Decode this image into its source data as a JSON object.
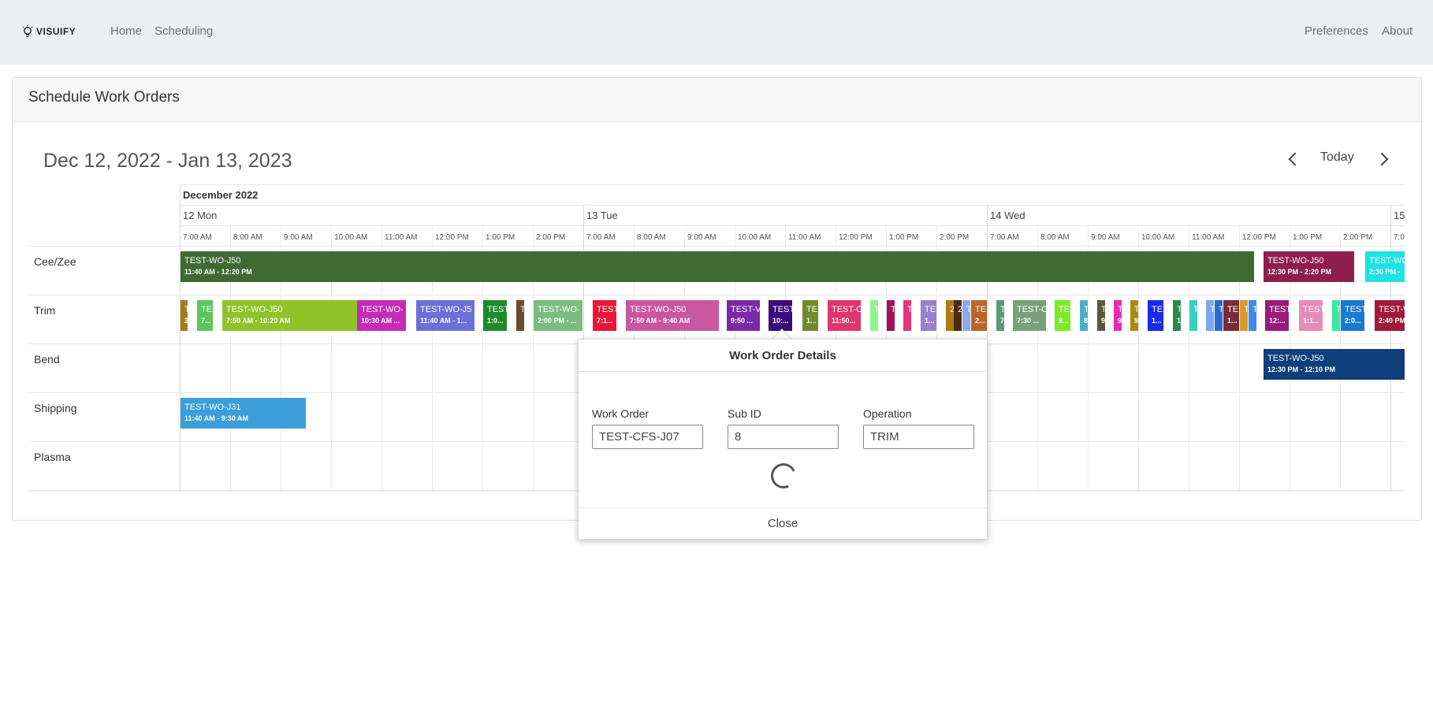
{
  "navbar": {
    "brand": "VISUIFY",
    "links": [
      "Home",
      "Scheduling"
    ],
    "right_links": [
      "Preferences",
      "About"
    ]
  },
  "card": {
    "title": "Schedule Work Orders"
  },
  "toolbar": {
    "range": "Dec 12, 2022 - Jan 13, 2023",
    "today_label": "Today"
  },
  "timeline": {
    "month": "December 2022",
    "days": [
      "12 Mon",
      "13 Tue",
      "14 Wed",
      "15"
    ],
    "hours": [
      "7:00 AM",
      "8:00 AM",
      "9:00 AM",
      "10:00 AM",
      "11:00 AM",
      "12:00 PM",
      "1:00 PM",
      "2:00 PM"
    ],
    "resources": [
      "Cee/Zee",
      "Trim",
      "Bend",
      "Shipping",
      "Plasma"
    ]
  },
  "events": [
    {
      "row": 0,
      "title": "TEST-WO-J50",
      "time": "11:40 AM - 12:20 PM",
      "color": "#3f6b32"
    },
    {
      "row": 0,
      "title": "TEST-WO-J50",
      "time": "12:30 PM - 2:20 PM",
      "color": "#8e1f4d"
    },
    {
      "row": 0,
      "title": "TEST-WO",
      "time": "2:30 PM -",
      "color": "#1de3e3"
    },
    {
      "row": 1,
      "title": "T",
      "time": "2",
      "color": "#a67c1a"
    },
    {
      "row": 1,
      "title": "TE",
      "time": "7...",
      "color": "#5bc75b"
    },
    {
      "row": 1,
      "title": "TEST-WO-J50",
      "time": "7:50 AM - 10:20 AM",
      "color": "#8ec42a"
    },
    {
      "row": 1,
      "title": "TEST-WO-",
      "time": "10:30 AM ...",
      "color": "#c72ab5"
    },
    {
      "row": 1,
      "title": "TEST-WO-J5",
      "time": "11:40 AM - 1...",
      "color": "#6b6fd8"
    },
    {
      "row": 1,
      "title": "TEST",
      "time": "1:0...",
      "color": "#1e8a2a"
    },
    {
      "row": 1,
      "title": "T",
      "time": "",
      "color": "#6b4a2a"
    },
    {
      "row": 1,
      "title": "TEST-WO-",
      "time": "2:00 PM - ...",
      "color": "#7bbd7f"
    },
    {
      "row": 1,
      "title": "TEST",
      "time": "7:1...",
      "color": "#e8163a"
    },
    {
      "row": 1,
      "title": "TEST-WO-J50",
      "time": "7:50 AM - 9:40 AM",
      "color": "#c956a0"
    },
    {
      "row": 1,
      "title": "TEST-V",
      "time": "9:50 ...",
      "color": "#7a2aa8"
    },
    {
      "row": 1,
      "title": "TEST",
      "time": "10:...",
      "color": "#3d0a7a"
    },
    {
      "row": 1,
      "title": "TE",
      "time": "1...",
      "color": "#6f8a2a"
    },
    {
      "row": 1,
      "title": "TEST-C",
      "time": "11:50...",
      "color": "#e0356e"
    },
    {
      "row": 1,
      "title": "T",
      "time": "",
      "color": "#8ff28f"
    },
    {
      "row": 1,
      "title": "T",
      "time": "",
      "color": "#a0105a"
    },
    {
      "row": 1,
      "title": "T",
      "time": "",
      "color": "#e8357a"
    },
    {
      "row": 1,
      "title": "TE",
      "time": "1...",
      "color": "#9a7fd0"
    },
    {
      "row": 1,
      "title": "2",
      "time": "",
      "color": "#b07a12"
    },
    {
      "row": 1,
      "title": "2",
      "time": "",
      "color": "#4a2a0a"
    },
    {
      "row": 1,
      "title": "T",
      "time": "",
      "color": "#8fa8e8"
    },
    {
      "row": 1,
      "title": "TE",
      "time": "2...",
      "color": "#b8662a"
    },
    {
      "row": 1,
      "title": "T",
      "time": "7",
      "color": "#5a9a7a"
    },
    {
      "row": 1,
      "title": "TEST-C",
      "time": "7:30 ...",
      "color": "#7aa07a"
    },
    {
      "row": 1,
      "title": "TE",
      "time": "8...",
      "color": "#7ee82a"
    },
    {
      "row": 1,
      "title": "T",
      "time": "8",
      "color": "#4ab0c8"
    },
    {
      "row": 1,
      "title": "T",
      "time": "9",
      "color": "#5a5a3a"
    },
    {
      "row": 1,
      "title": "T",
      "time": "9",
      "color": "#e82ab0"
    },
    {
      "row": 1,
      "title": "T",
      "time": "9",
      "color": "#a88a12"
    },
    {
      "row": 1,
      "title": "TE",
      "time": "1...",
      "color": "#1a2ae8"
    },
    {
      "row": 1,
      "title": "T",
      "time": "1",
      "color": "#2a8a4a"
    },
    {
      "row": 1,
      "title": "T",
      "time": "",
      "color": "#3ad0c0"
    },
    {
      "row": 1,
      "title": "T",
      "time": "",
      "color": "#7aa8e8"
    },
    {
      "row": 1,
      "title": "T",
      "time": "",
      "color": "#2a6ad0"
    },
    {
      "row": 1,
      "title": "TE",
      "time": "1...",
      "color": "#7a2a3a"
    },
    {
      "row": 1,
      "title": "T",
      "time": "",
      "color": "#d89a2a"
    },
    {
      "row": 1,
      "title": "T",
      "time": "",
      "color": "#3a8ae8"
    },
    {
      "row": 1,
      "title": "TEST",
      "time": "12:...",
      "color": "#9a1a7a"
    },
    {
      "row": 1,
      "title": "TEST",
      "time": "1:1...",
      "color": "#e88ab8"
    },
    {
      "row": 1,
      "title": "T",
      "time": "",
      "color": "#3ae8a0"
    },
    {
      "row": 1,
      "title": "TEST",
      "time": "2:0...",
      "color": "#1a7ad0"
    },
    {
      "row": 1,
      "title": "TEST-W",
      "time": "2:40 PM",
      "color": "#a01a3a"
    },
    {
      "row": 2,
      "title": "TEST-WO-J50",
      "time": "12:30 PM - 12:10 PM",
      "color": "#0e3f7a"
    },
    {
      "row": 3,
      "title": "TEST-WO-J31",
      "time": "11:40 AM - 9:30 AM",
      "color": "#3a9fd8"
    }
  ],
  "popup": {
    "title": "Work Order Details",
    "fields": [
      {
        "label": "Work Order",
        "value": "TEST-CFS-J07"
      },
      {
        "label": "Sub ID",
        "value": "8"
      },
      {
        "label": "Operation",
        "value": "TRIM"
      }
    ],
    "close_label": "Close"
  }
}
